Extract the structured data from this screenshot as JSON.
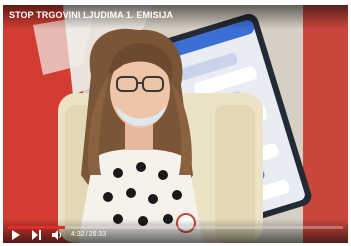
{
  "video": {
    "title": "STOP TRGOVINI LJUDIMA 1. EMISIJA",
    "current_time": "4:32",
    "separator": "/",
    "duration": "26:33",
    "progress": 0.171
  },
  "icons": {
    "play": "play-icon",
    "next": "next-icon",
    "volume": "volume-icon"
  },
  "colors": {
    "progress": "#e52b2b",
    "background_red": "#c9473d",
    "phone_blue": "#3b6fd6"
  }
}
